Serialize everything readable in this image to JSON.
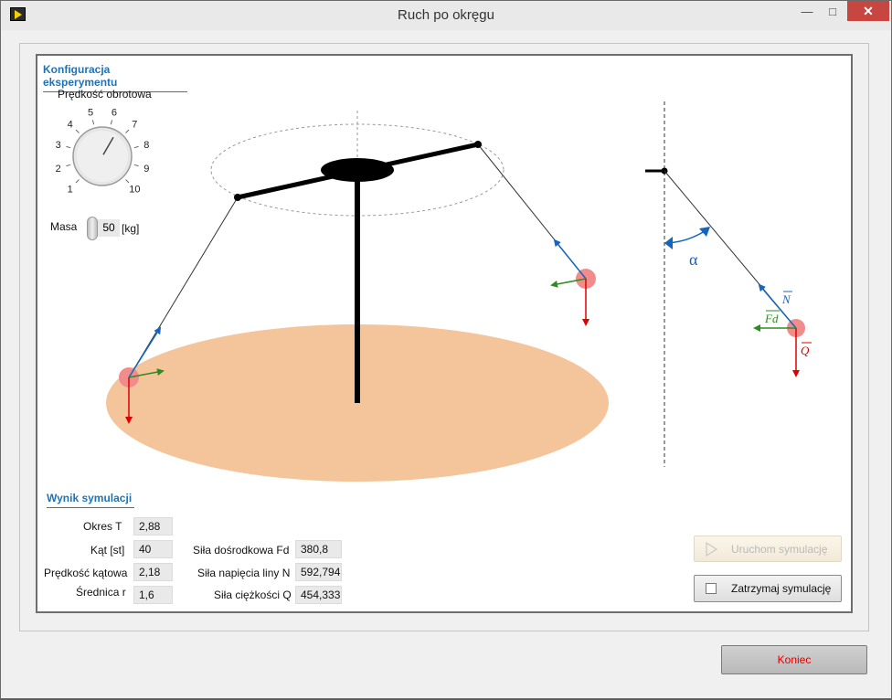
{
  "window": {
    "title": "Ruch po okręgu"
  },
  "config": {
    "section_title": "Konfiguracja eksperymentu",
    "knob_label": "Prędkość obrotowa",
    "knob_ticks": [
      "1",
      "2",
      "3",
      "4",
      "5",
      "6",
      "7",
      "8",
      "9",
      "10"
    ],
    "knob_value": 6.5,
    "mass_label": "Masa",
    "mass_value": "50",
    "mass_unit": "[kg]"
  },
  "diagram": {
    "alpha": "α",
    "N": "N",
    "Fd": "Fd",
    "Q": "Q"
  },
  "results": {
    "section_title": "Wynik symulacji",
    "period_label": "Okres T",
    "period_value": "2,88",
    "angle_label": "Kąt [st]",
    "angle_value": "40",
    "angular_speed_label": "Prędkość kątowa",
    "angular_speed_value": "2,18",
    "diameter_label": "Średnica r",
    "diameter_value": "1,6",
    "centripetal_label": "Siła dośrodkowa Fd",
    "centripetal_value": "380,8",
    "tension_label": "Siła napięcia liny N",
    "tension_value": "592,794",
    "gravity_label": "Siła ciężkości Q",
    "gravity_value": "454,333"
  },
  "buttons": {
    "run": "Uruchom symulację",
    "stop": "Zatrzymaj symulację",
    "quit": "Koniec"
  },
  "colors": {
    "accent": "#1f73b5",
    "ground": "#f4c49a",
    "mass": "#f28c8c",
    "tension_arrow": "#1565c0",
    "centripetal_arrow": "#2e8b22",
    "gravity_arrow": "#e00000",
    "quit_text": "#e00000"
  }
}
